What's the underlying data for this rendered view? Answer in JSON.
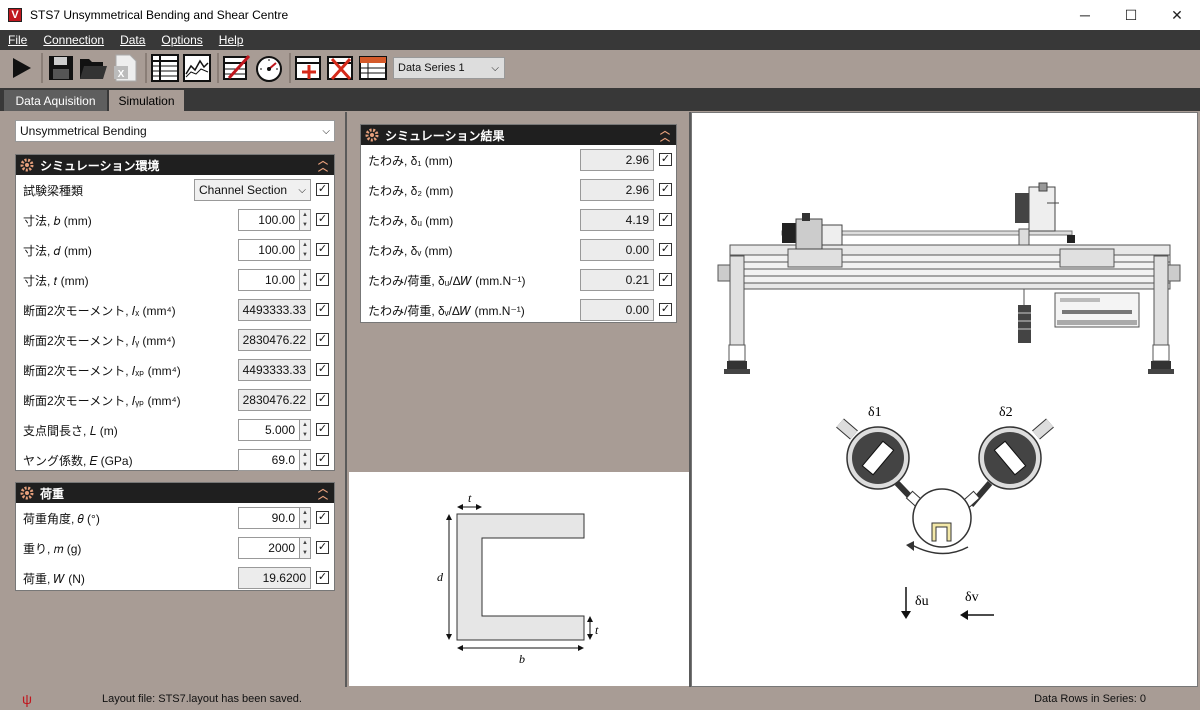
{
  "window": {
    "title": "STS7 Unsymmetrical Bending and Shear Centre",
    "icon_letter": "V",
    "minimize": "─",
    "maximize": "☐",
    "close": "✕"
  },
  "menu": [
    "File",
    "Connection",
    "Data",
    "Options",
    "Help"
  ],
  "toolbar": {
    "series_selected": "Data Series 1",
    "series_arrow": "⌵"
  },
  "tabs": [
    "Data Aquisition",
    "Simulation"
  ],
  "mode_select": {
    "value": "Unsymmetrical Bending",
    "arrow": "⌵"
  },
  "environment": {
    "title": "シミュレーション環境",
    "rows": [
      {
        "label": "試験梁種類",
        "type": "select",
        "value": "Channel Section",
        "checked": true
      },
      {
        "label": "寸法, 𝑏 (mm)",
        "type": "spin",
        "value": "100.00",
        "checked": true
      },
      {
        "label": "寸法, 𝑑 (mm)",
        "type": "spin",
        "value": "100.00",
        "checked": true
      },
      {
        "label": "寸法, 𝑡 (mm)",
        "type": "spin",
        "value": "10.00",
        "checked": true
      },
      {
        "label": "断面2次モーメント, 𝐼ₓ (mm⁴)",
        "type": "ro",
        "value": "4493333.33",
        "checked": true
      },
      {
        "label": "断面2次モーメント, 𝐼ᵧ (mm⁴)",
        "type": "ro",
        "value": "2830476.22",
        "checked": true
      },
      {
        "label": "断面2次モーメント, 𝐼ₓₚ (mm⁴)",
        "type": "ro",
        "value": "4493333.33",
        "checked": true
      },
      {
        "label": "断面2次モーメント, 𝐼ᵧₚ (mm⁴)",
        "type": "ro",
        "value": "2830476.22",
        "checked": true
      },
      {
        "label": "支点間長さ, 𝐿 (m)",
        "type": "spin",
        "value": "5.000",
        "checked": true
      },
      {
        "label": "ヤング係数, 𝐸 (GPa)",
        "type": "spin",
        "value": "69.0",
        "checked": true
      }
    ]
  },
  "load": {
    "title": "荷重",
    "rows": [
      {
        "label": "荷重角度, 𝜃 (°)",
        "type": "spin",
        "value": "90.0",
        "checked": true
      },
      {
        "label": "重り, 𝑚 (g)",
        "type": "spin",
        "value": "2000",
        "checked": true
      },
      {
        "label": "荷重, 𝑊 (N)",
        "type": "ro",
        "value": "19.6200",
        "checked": true
      }
    ]
  },
  "results": {
    "title": "シミュレーション結果",
    "rows": [
      {
        "label": "たわみ, δ₁ (mm)",
        "value": "2.96",
        "checked": true
      },
      {
        "label": "たわみ, δ₂ (mm)",
        "value": "2.96",
        "checked": true
      },
      {
        "label": "たわみ, δᵤ (mm)",
        "value": "4.19",
        "checked": true
      },
      {
        "label": "たわみ, δᵥ (mm)",
        "value": "0.00",
        "checked": true
      },
      {
        "label": "たわみ/荷重, δᵤ/Δ𝑊 (mm.N⁻¹)",
        "value": "0.21",
        "checked": true
      },
      {
        "label": "たわみ/荷重, δᵥ/Δ𝑊 (mm.N⁻¹)",
        "value": "0.00",
        "checked": true
      }
    ]
  },
  "section_diagram": {
    "t": "t",
    "d": "d",
    "b": "b"
  },
  "gauge_diagram": {
    "delta1": "δ1",
    "delta2": "δ2",
    "delta_u": "δu",
    "delta_v": "δv"
  },
  "status": {
    "message": "Layout file: STS7.layout has been saved.",
    "rows": "Data Rows in Series: 0"
  },
  "colors": {
    "accent": "#e7a07c",
    "panel_header": "#1f1f1f",
    "background": "#a89c95",
    "menubar": "#383838"
  }
}
